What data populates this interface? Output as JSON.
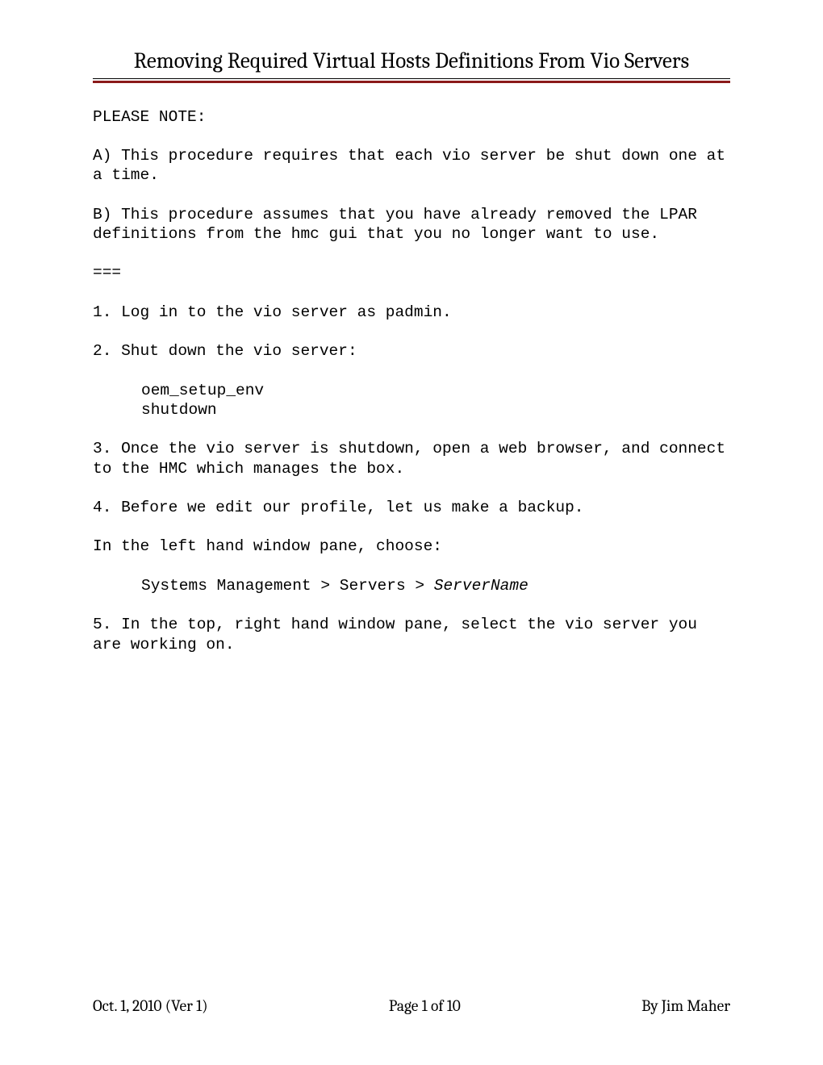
{
  "title": "Removing Required Virtual Hosts Definitions From Vio Servers",
  "body": {
    "note_label": "PLEASE NOTE:",
    "note_a": "A) This procedure requires that each vio server be shut down one at a time.",
    "note_b": "B) This procedure assumes that you have already removed the LPAR definitions from the hmc gui that you no longer want to use.",
    "separator": "===",
    "step1": "1. Log in to the vio server as padmin.",
    "step2": "2. Shut down the vio server:",
    "cmd1": "oem_setup_env",
    "cmd2": "shutdown",
    "step3": "3. Once the vio server is shutdown, open a web browser, and connect to the HMC which manages the box.",
    "step4": "4. Before we edit our profile, let us make a backup.",
    "step4b": "In the left hand window pane, choose:",
    "nav_prefix": "Systems Management > Servers > ",
    "nav_italic": "ServerName",
    "step5": "5. In the top, right hand window pane, select the vio server you are working on."
  },
  "footer": {
    "left": "Oct. 1, 2010 (Ver 1)",
    "center": "Page 1 of 10",
    "right": "By Jim Maher"
  }
}
